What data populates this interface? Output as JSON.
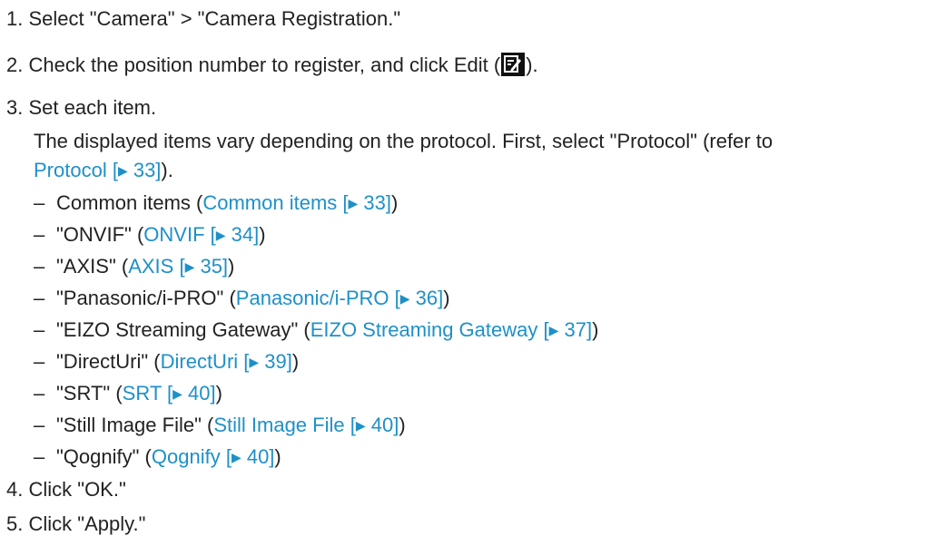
{
  "steps": [
    {
      "num": "1.",
      "text": "Select \"Camera\" > \"Camera Registration.\""
    },
    {
      "num": "2.",
      "text_before": "Check the position number to register, and click Edit (",
      "icon": "edit-icon",
      "text_after": ")."
    },
    {
      "num": "3.",
      "text": "Set each item."
    },
    {
      "num": "4.",
      "text": "Click \"OK.\""
    },
    {
      "num": "5.",
      "text": "Click \"Apply.\""
    }
  ],
  "step3_note": {
    "line1": "The displayed items vary depending on the protocol. First, select \"Protocol\" (refer to",
    "link": "Protocol [",
    "link_arrow": "▶",
    "link_page": " 33]",
    "tail": ")."
  },
  "sub_items": [
    {
      "prefix": "Common items (",
      "link": "Common items [",
      "arrow": "▶",
      "page": " 33]",
      "suffix": ")"
    },
    {
      "prefix": "\"ONVIF\" (",
      "link": "ONVIF [",
      "arrow": "▶",
      "page": " 34]",
      "suffix": ")"
    },
    {
      "prefix": "\"AXIS\" (",
      "link": "AXIS [",
      "arrow": "▶",
      "page": " 35]",
      "suffix": ")"
    },
    {
      "prefix": "\"Panasonic/i-PRO\" (",
      "link": "Panasonic/i-PRO [",
      "arrow": "▶",
      "page": " 36]",
      "suffix": ")"
    },
    {
      "prefix": "\"EIZO Streaming Gateway\" (",
      "link": "EIZO Streaming Gateway [",
      "arrow": "▶",
      "page": " 37]",
      "suffix": ")"
    },
    {
      "prefix": "\"DirectUri\" (",
      "link": "DirectUri [",
      "arrow": "▶",
      "page": " 39]",
      "suffix": ")"
    },
    {
      "prefix": "\"SRT\" (",
      "link": "SRT [",
      "arrow": "▶",
      "page": " 40]",
      "suffix": ")"
    },
    {
      "prefix": "\"Still Image File\" (",
      "link": "Still Image File [",
      "arrow": "▶",
      "page": " 40]",
      "suffix": ")"
    },
    {
      "prefix": "\"Qognify\" (",
      "link": "Qognify [",
      "arrow": "▶",
      "page": " 40]",
      "suffix": ")"
    }
  ],
  "dash": "–",
  "colors": {
    "text": "#222222",
    "link": "#1e90c8",
    "icon_bg": "#111111"
  }
}
